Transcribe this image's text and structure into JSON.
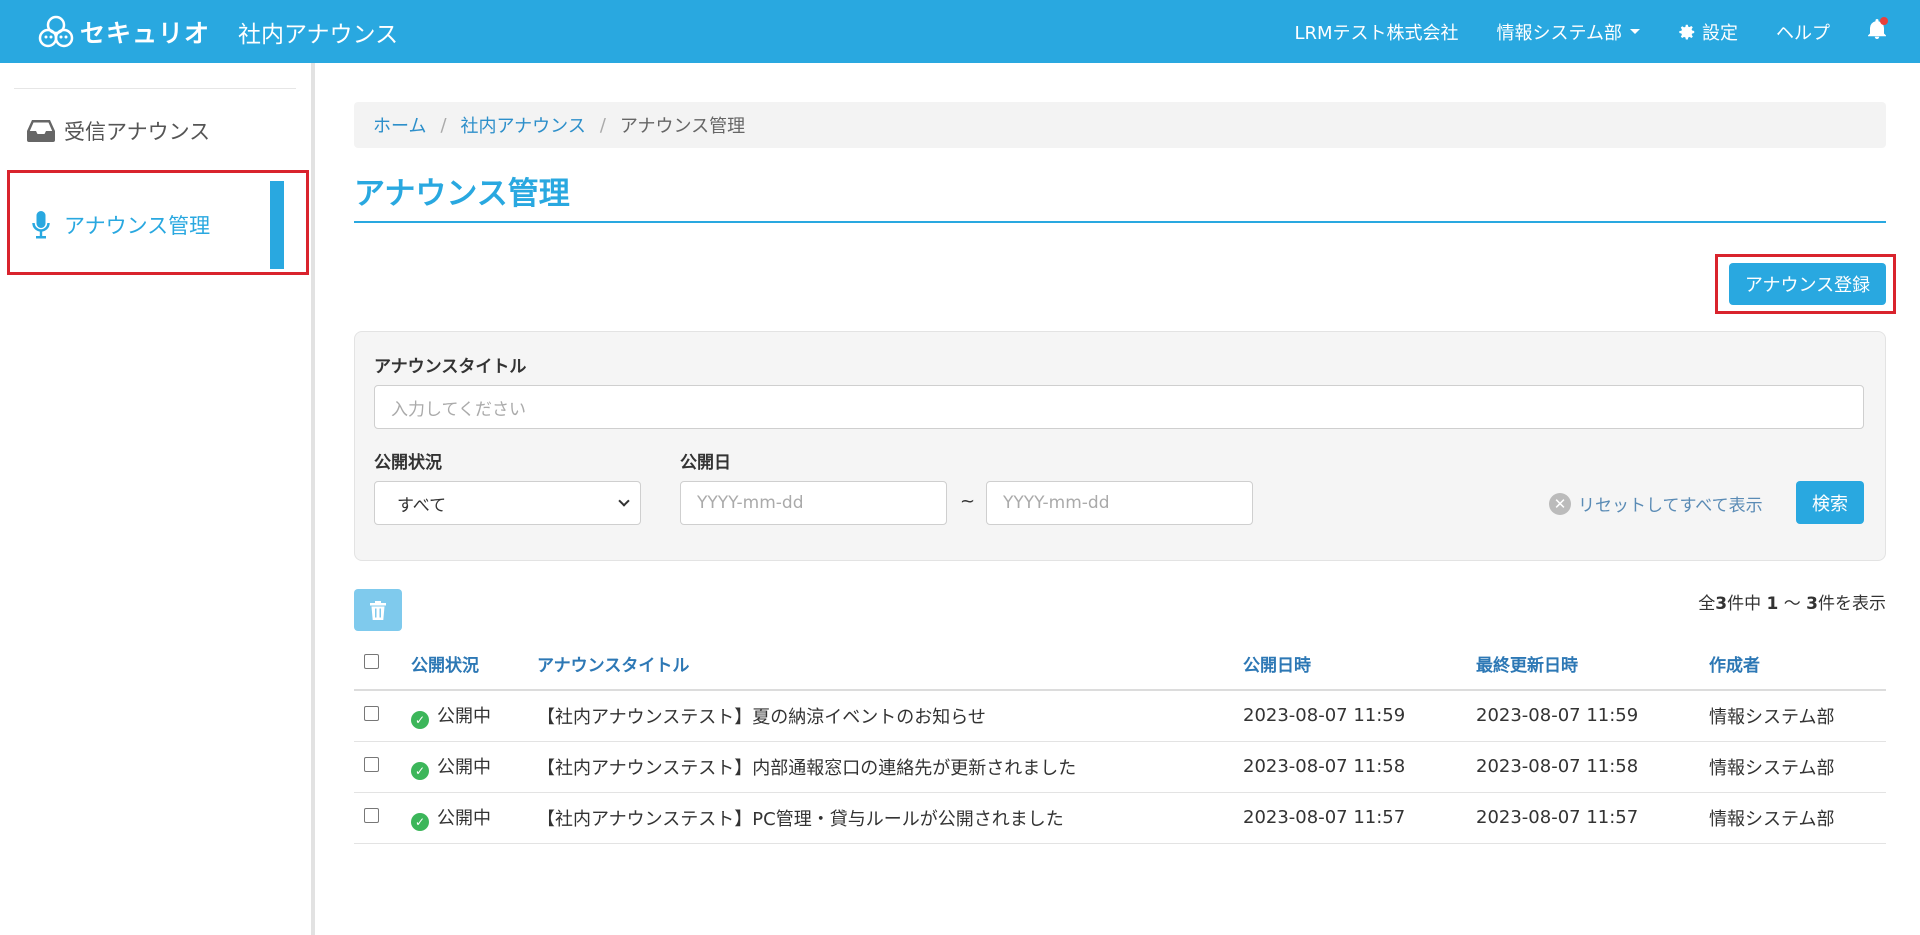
{
  "header": {
    "logo_text": "セキュリオ",
    "app_title": "社内アナウンス",
    "company": "LRMテスト株式会社",
    "department": "情報システム部",
    "settings": "設定",
    "help": "ヘルプ"
  },
  "sidebar": {
    "items": [
      {
        "label": "受信アナウンス",
        "icon": "inbox-icon"
      },
      {
        "label": "アナウンス管理",
        "icon": "microphone-icon",
        "active": true
      }
    ]
  },
  "breadcrumb": {
    "home": "ホーム",
    "section": "社内アナウンス",
    "current": "アナウンス管理"
  },
  "page": {
    "title": "アナウンス管理",
    "register_button": "アナウンス登録"
  },
  "search": {
    "title_label": "アナウンスタイトル",
    "title_placeholder": "入力してください",
    "status_label": "公開状況",
    "status_value": "すべて",
    "date_label": "公開日",
    "date_from_placeholder": "YYYY-mm-dd",
    "date_separator": "~",
    "date_to_placeholder": "YYYY-mm-dd",
    "reset_label": "リセットしてすべて表示",
    "search_button": "検索"
  },
  "results": {
    "count_prefix": "全",
    "total": "3",
    "count_mid": "件中",
    "range_start": "1",
    "range_sep": "〜",
    "range_end": "3",
    "count_suffix": "件を表示"
  },
  "table": {
    "headers": [
      "公開状況",
      "アナウンスタイトル",
      "公開日時",
      "最終更新日時",
      "作成者"
    ],
    "rows": [
      {
        "status": "公開中",
        "title": "【社内アナウンステスト】夏の納涼イベントのお知らせ",
        "published": "2023-08-07 11:59",
        "updated": "2023-08-07 11:59",
        "author": "情報システム部"
      },
      {
        "status": "公開中",
        "title": "【社内アナウンステスト】内部通報窓口の連絡先が更新されました",
        "published": "2023-08-07 11:58",
        "updated": "2023-08-07 11:58",
        "author": "情報システム部"
      },
      {
        "status": "公開中",
        "title": "【社内アナウンステスト】PC管理・貸与ルールが公開されました",
        "published": "2023-08-07 11:57",
        "updated": "2023-08-07 11:57",
        "author": "情報システム部"
      }
    ]
  },
  "colors": {
    "brand": "#29a8e0",
    "highlight": "#d9232d",
    "status_ok": "#3cb65a"
  }
}
